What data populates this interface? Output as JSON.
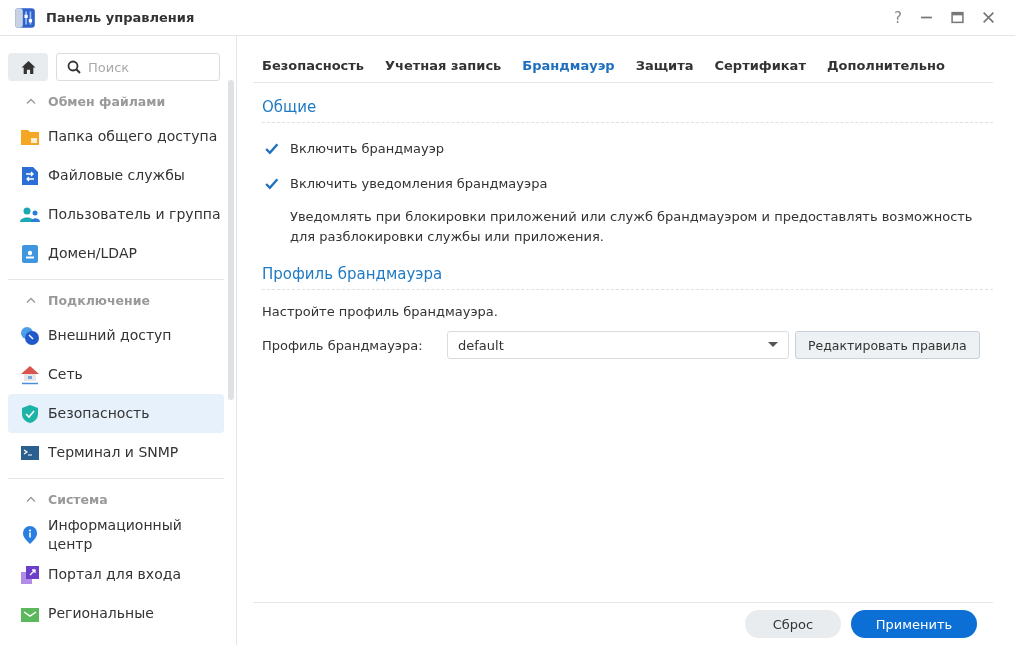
{
  "window": {
    "title": "Панель управления",
    "controls": [
      "?"
    ]
  },
  "sidebar": {
    "search": {
      "placeholder": "Поиск"
    },
    "groups": [
      {
        "label": "Обмен файлами",
        "expanded": true,
        "items": [
          {
            "label": "Папка общего доступа",
            "kind": "folder",
            "selected": false
          },
          {
            "label": "Файловые службы",
            "kind": "files",
            "selected": false
          },
          {
            "label": "Пользователь и группа",
            "kind": "users",
            "selected": false
          },
          {
            "label": "Домен/LDAP",
            "kind": "domain",
            "selected": false
          }
        ]
      },
      {
        "label": "Подключение",
        "expanded": true,
        "items": [
          {
            "label": "Внешний доступ",
            "kind": "external",
            "selected": false
          },
          {
            "label": "Сеть",
            "kind": "network",
            "selected": false
          },
          {
            "label": "Безопасность",
            "kind": "shield",
            "selected": true
          },
          {
            "label": "Терминал и SNMP",
            "kind": "terminal",
            "selected": false
          }
        ]
      },
      {
        "label": "Система",
        "expanded": true,
        "items": [
          {
            "label": "Информационный центр",
            "kind": "info",
            "selected": false
          },
          {
            "label": "Портал для входа",
            "kind": "portal",
            "selected": false
          },
          {
            "label": "Региональные",
            "kind": "regional",
            "selected": false
          }
        ]
      }
    ]
  },
  "tabs": [
    {
      "label": "Безопасность",
      "selected": false
    },
    {
      "label": "Учетная запись",
      "selected": false
    },
    {
      "label": "Брандмауэр",
      "selected": true
    },
    {
      "label": "Защита",
      "selected": false
    },
    {
      "label": "Сертификат",
      "selected": false
    },
    {
      "label": "Дополнительно",
      "selected": false
    }
  ],
  "general": {
    "title": "Общие",
    "options": [
      {
        "label": "Включить брандмауэр",
        "checked": true
      },
      {
        "label": "Включить уведомления брандмауэра",
        "checked": true
      }
    ],
    "description": "Уведомлять при блокировки приложений или служб брандмауэром и предоставлять возможность для разблокировки службы или приложения."
  },
  "profile": {
    "title": "Профиль брандмауэра",
    "hint": "Настройте профиль брандмауэра.",
    "label": "Профиль брандмауэра:",
    "value": "default",
    "edit_button": "Редактировать правила"
  },
  "buttons": [
    {
      "label": "Сброс",
      "kind": "secondary"
    },
    {
      "label": "Применить",
      "kind": "primary"
    }
  ]
}
